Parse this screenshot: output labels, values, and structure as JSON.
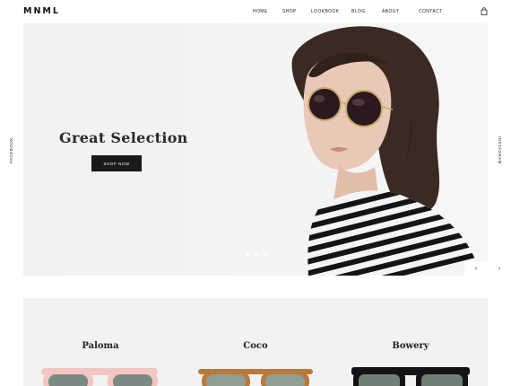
{
  "brand": {
    "logo": "MNML"
  },
  "nav": {
    "items": [
      "HOME",
      "SHOP",
      "LOOKBOOK",
      "BLOG",
      "ABOUT",
      "CONTACT"
    ],
    "cart_icon": "shopping-bag-icon"
  },
  "hero": {
    "title": "Great Selection",
    "cta_label": "SHOP NOW",
    "slide_count": 3,
    "active_slide": 1,
    "prev_label": "‹",
    "next_label": "›"
  },
  "social": {
    "left": "FACEBOOK",
    "right": "INSTAGRAM"
  },
  "products": [
    {
      "name": "Paloma",
      "frame_color": "#f3c5c0",
      "lens_color": "#7a8a82"
    },
    {
      "name": "Coco",
      "frame_color": "#b8793f",
      "lens_color": "#8f9f90"
    },
    {
      "name": "Bowery",
      "frame_color": "#141414",
      "lens_color": "#6f7f74"
    }
  ]
}
